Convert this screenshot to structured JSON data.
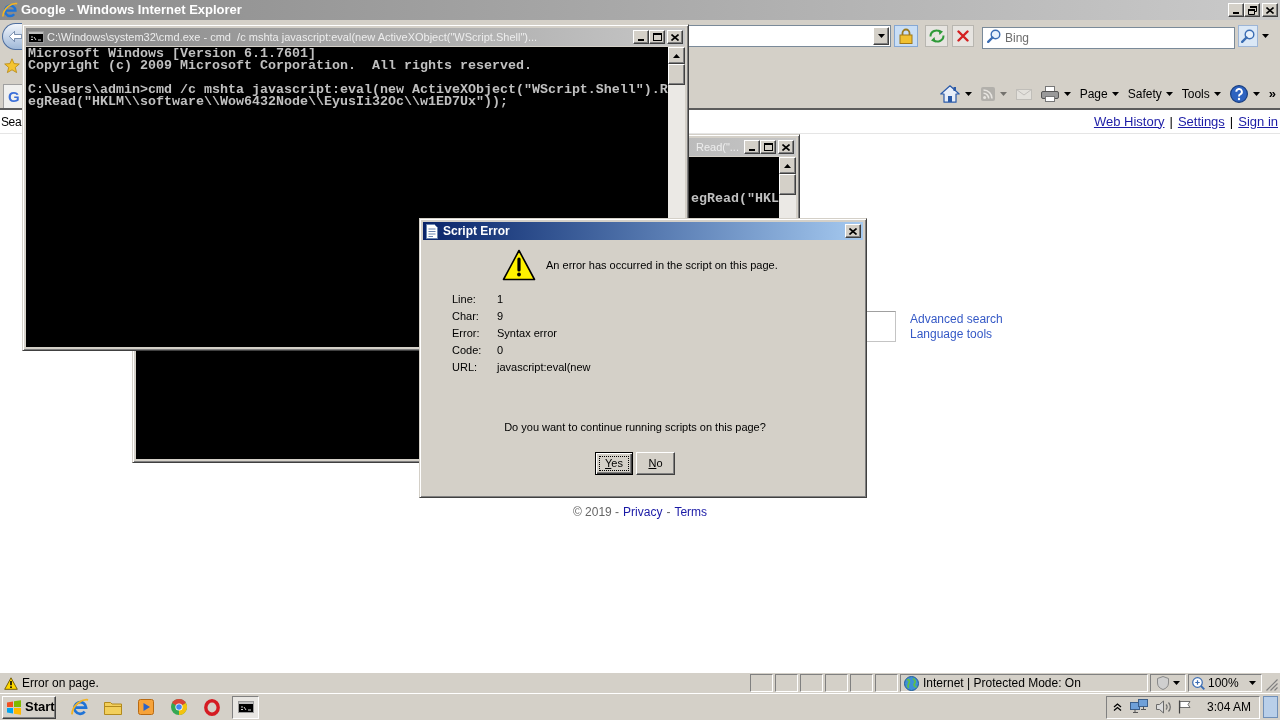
{
  "browser": {
    "title": "Google - Windows Internet Explorer",
    "search_box": {
      "placeholder": "Bing"
    },
    "tab": {
      "favicon": "G"
    },
    "command_bar": [
      {
        "kind": "home",
        "disabled": false
      },
      {
        "kind": "feeds",
        "disabled": true
      },
      {
        "kind": "mail",
        "disabled": true
      },
      {
        "kind": "print",
        "disabled": false
      },
      {
        "kind": "menu",
        "label": "Page",
        "disabled": false
      },
      {
        "kind": "menu",
        "label": "Safety",
        "disabled": false
      },
      {
        "kind": "menu",
        "label": "Tools",
        "disabled": false
      },
      {
        "kind": "help",
        "disabled": false
      },
      {
        "kind": "overflow",
        "label": "»",
        "disabled": false
      }
    ],
    "page": {
      "top_left_text": "Sea",
      "top_links": [
        {
          "kind": "link",
          "text": "Web History"
        },
        {
          "kind": "separator",
          "text": "|"
        },
        {
          "kind": "link",
          "text": "Settings"
        },
        {
          "kind": "separator",
          "text": "|"
        },
        {
          "kind": "link",
          "text": "Sign in"
        }
      ],
      "side_links": [
        "Advanced search",
        "Language tools"
      ],
      "footer": [
        {
          "kind": "text",
          "text": "© 2019 -"
        },
        {
          "kind": "link",
          "text": "Privacy"
        },
        {
          "kind": "text",
          "text": "-"
        },
        {
          "kind": "link",
          "text": "Terms"
        }
      ]
    },
    "status_bar": {
      "message": "Error on page.",
      "zone": "Internet | Protected Mode: On",
      "zoom": "100%"
    }
  },
  "console_back": {
    "title": "Read(\"...",
    "lines": [
      "egRead(\"HKL"
    ]
  },
  "console_front": {
    "title": "C:\\Windows\\system32\\cmd.exe - cmd  /c mshta javascript:eval(new ActiveXObject(\"WScript.Shell\")...",
    "blocks": [
      [
        "Microsoft Windows [Version 6.1.7601]",
        "Copyright (c) 2009 Microsoft Corporation.  All rights reserved."
      ],
      [
        "C:\\Users\\admin>cmd /c mshta javascript:eval(new ActiveXObject(\"WScript.Shell\").R",
        "egRead(\"HKLM\\\\software\\\\Wow6432Node\\\\EyusIi32Oc\\\\w1ED7Ux\"));"
      ]
    ]
  },
  "dialog": {
    "title": "Script Error",
    "message": "An error has occurred in the script on this page.",
    "details": [
      {
        "label": "Line:",
        "value": "1"
      },
      {
        "label": "Char:",
        "value": "9"
      },
      {
        "label": "Error:",
        "value": "Syntax error"
      },
      {
        "label": "Code:",
        "value": "0"
      },
      {
        "label": "URL:",
        "value": "javascript:eval(new"
      }
    ],
    "question": "Do you want to continue running scripts on this page?",
    "buttons": [
      {
        "label": "Yes",
        "focused": true
      },
      {
        "label": "No",
        "focused": false
      }
    ]
  },
  "taskbar": {
    "start": "Start",
    "apps": [
      {
        "kind": "e-logo",
        "active": false
      },
      {
        "kind": "folder",
        "active": false
      },
      {
        "kind": "media",
        "active": false
      },
      {
        "kind": "ball",
        "active": false
      },
      {
        "kind": "ring",
        "active": false
      },
      {
        "kind": "console",
        "active": true
      }
    ],
    "clock": "3:04 AM"
  }
}
